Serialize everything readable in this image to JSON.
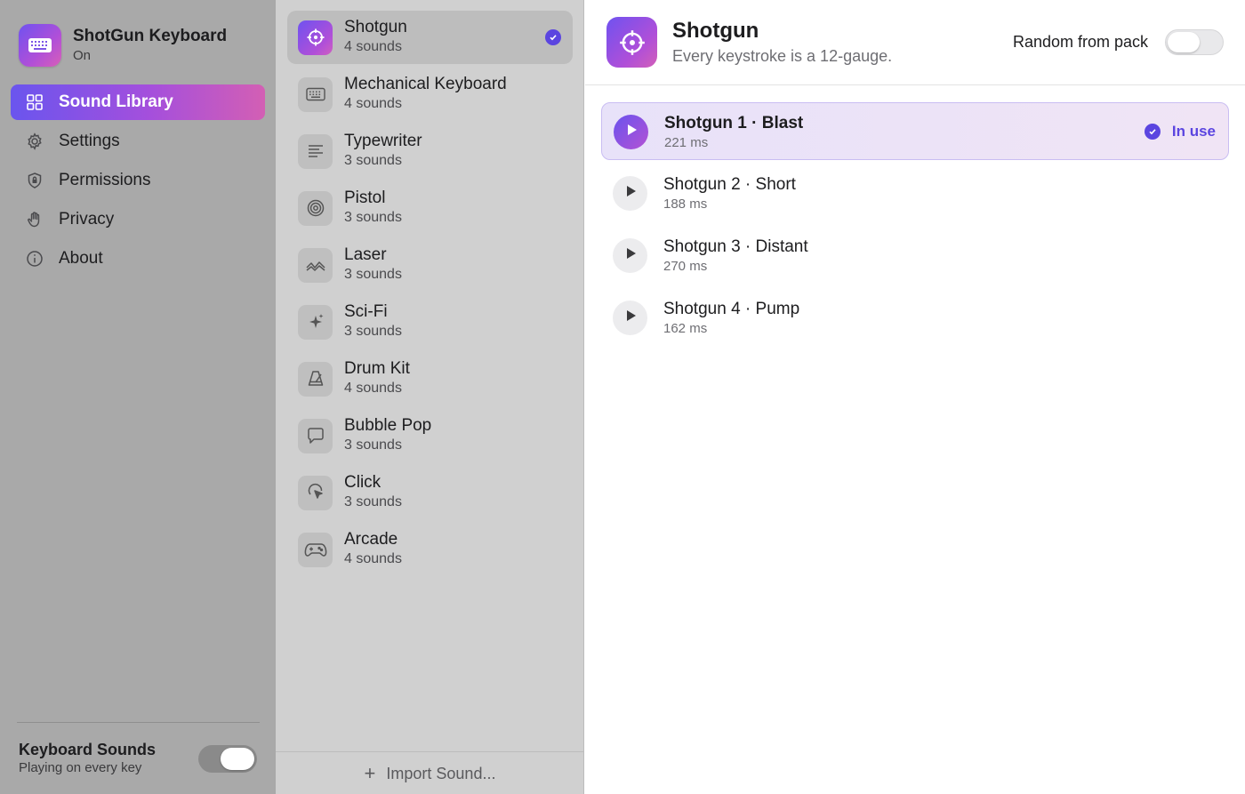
{
  "app": {
    "title": "ShotGun Keyboard",
    "status": "On"
  },
  "nav": [
    {
      "label": "Sound Library",
      "icon": "grid-icon",
      "active": true
    },
    {
      "label": "Settings",
      "icon": "gear-icon",
      "active": false
    },
    {
      "label": "Permissions",
      "icon": "shield-icon",
      "active": false
    },
    {
      "label": "Privacy",
      "icon": "hand-icon",
      "active": false
    },
    {
      "label": "About",
      "icon": "info-icon",
      "active": false
    }
  ],
  "keyboard_sounds": {
    "title": "Keyboard Sounds",
    "subtitle": "Playing on every key",
    "enabled": true
  },
  "packs": [
    {
      "name": "Shotgun",
      "count": "4 sounds",
      "icon": "crosshair-icon",
      "selected": true
    },
    {
      "name": "Mechanical Keyboard",
      "count": "4 sounds",
      "icon": "keyboard-icon",
      "selected": false
    },
    {
      "name": "Typewriter",
      "count": "3 sounds",
      "icon": "text-lines-icon",
      "selected": false
    },
    {
      "name": "Pistol",
      "count": "3 sounds",
      "icon": "target-icon",
      "selected": false
    },
    {
      "name": "Laser",
      "count": "3 sounds",
      "icon": "wave-icon",
      "selected": false
    },
    {
      "name": "Sci-Fi",
      "count": "3 sounds",
      "icon": "sparkles-icon",
      "selected": false
    },
    {
      "name": "Drum Kit",
      "count": "4 sounds",
      "icon": "metronome-icon",
      "selected": false
    },
    {
      "name": "Bubble Pop",
      "count": "3 sounds",
      "icon": "speech-bubble-icon",
      "selected": false
    },
    {
      "name": "Click",
      "count": "3 sounds",
      "icon": "cursor-click-icon",
      "selected": false
    },
    {
      "name": "Arcade",
      "count": "4 sounds",
      "icon": "gamepad-icon",
      "selected": false
    }
  ],
  "import_label": "Import Sound...",
  "detail": {
    "title": "Shotgun",
    "subtitle": "Every keystroke is a 12-gauge.",
    "random_label": "Random from pack",
    "random_enabled": false,
    "sounds": [
      {
        "name": "Shotgun 1 · Blast",
        "duration": "221 ms",
        "in_use": true
      },
      {
        "name": "Shotgun 2 · Short",
        "duration": "188 ms",
        "in_use": false
      },
      {
        "name": "Shotgun 3 · Distant",
        "duration": "270 ms",
        "in_use": false
      },
      {
        "name": "Shotgun 4 · Pump",
        "duration": "162 ms",
        "in_use": false
      }
    ],
    "in_use_label": "In use"
  },
  "colors": {
    "accent": "#5b45e0",
    "gradient_start": "#6f52f0",
    "gradient_end": "#d35fb8"
  }
}
